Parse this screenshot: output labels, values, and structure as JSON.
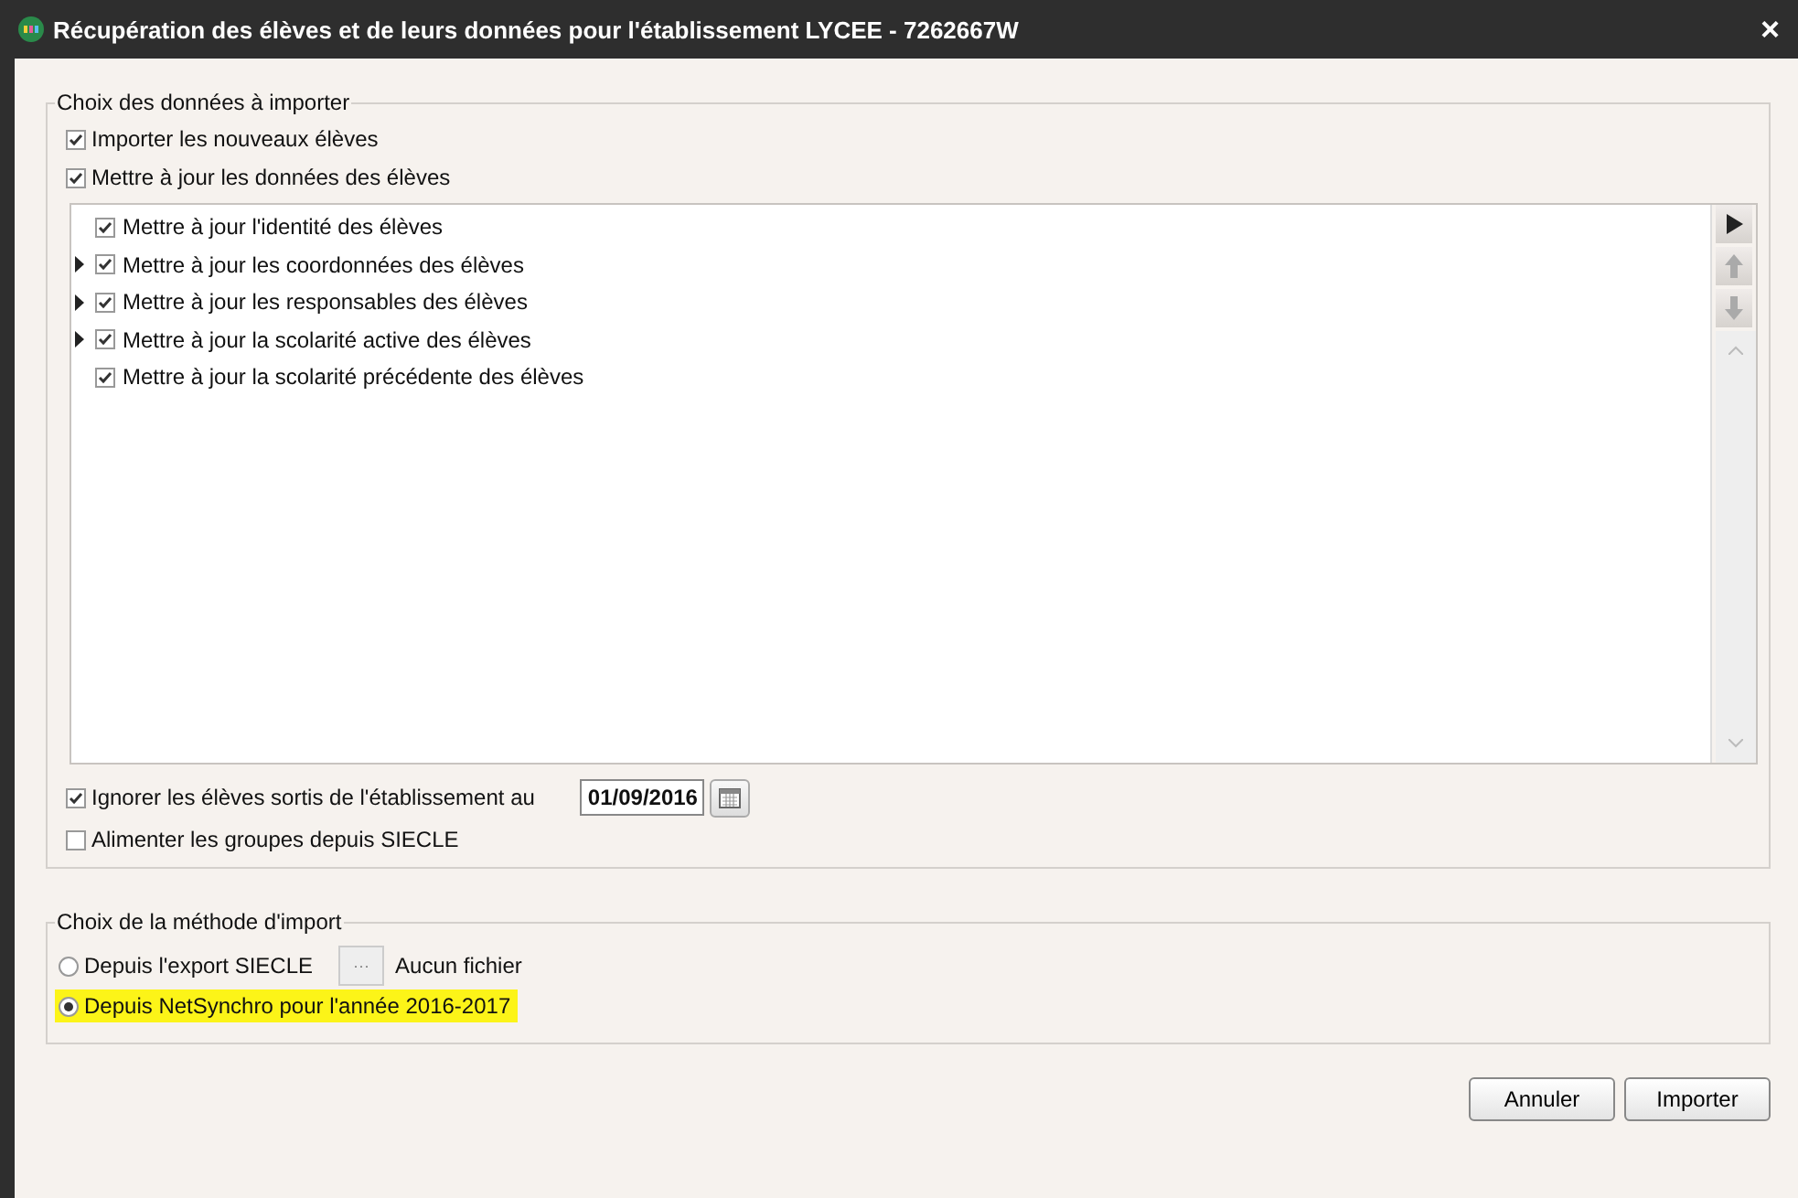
{
  "window": {
    "title": "Récupération des élèves et de leurs données pour l'établissement LYCEE - 7262667W",
    "close": "×"
  },
  "data_group": {
    "legend": "Choix des données à importer",
    "options": [
      {
        "label": "Importer les nouveaux élèves",
        "checked": true
      },
      {
        "label": "Mettre à jour les données des élèves",
        "checked": true
      }
    ],
    "tree": [
      {
        "label": "Mettre à jour l'identité des élèves",
        "checked": true,
        "expandable": false
      },
      {
        "label": "Mettre à jour les coordonnées des élèves",
        "checked": true,
        "expandable": true
      },
      {
        "label": "Mettre à jour les responsables des élèves",
        "checked": true,
        "expandable": true
      },
      {
        "label": "Mettre à jour la scolarité active des élèves",
        "checked": true,
        "expandable": true
      },
      {
        "label": "Mettre à jour la scolarité précédente des élèves",
        "checked": true,
        "expandable": false
      }
    ],
    "ignore": {
      "label": "Ignorer les élèves sortis de l'établissement au",
      "checked": true,
      "date": "01/09/2016"
    },
    "groups": {
      "label": "Alimenter les groupes depuis SIECLE",
      "checked": false
    }
  },
  "method_group": {
    "legend": "Choix de la méthode d'import",
    "options": [
      {
        "kind": "file",
        "label": "Depuis l'export SIECLE",
        "selected": false,
        "highlighted": false,
        "browse": "···",
        "file": "Aucun fichier"
      },
      {
        "kind": "plain",
        "label": "Depuis NetSynchro pour l'année 2016-2017",
        "selected": true,
        "highlighted": true
      }
    ]
  },
  "buttons": [
    "Annuler",
    "Importer"
  ]
}
